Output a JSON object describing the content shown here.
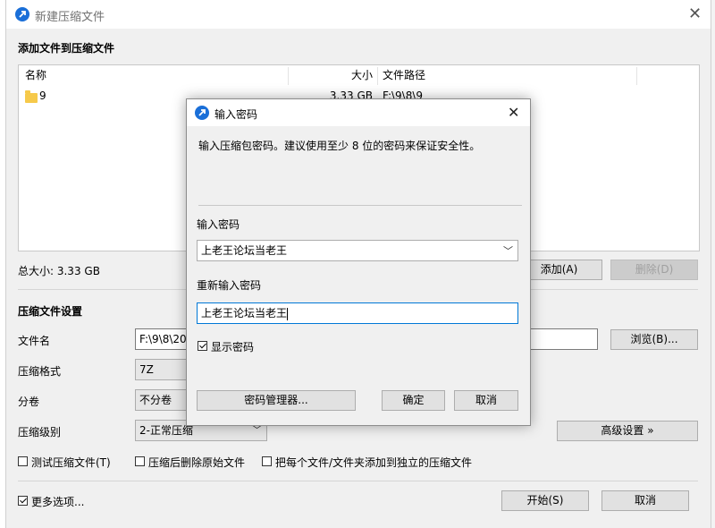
{
  "window": {
    "title": "新建压缩文件",
    "add_files_heading": "添加文件到压缩文件"
  },
  "file_list": {
    "columns": [
      "名称",
      "大小",
      "文件路径"
    ],
    "rows": [
      {
        "name": "9",
        "size": "3.33 GB",
        "path": "F:\\9\\8\\9"
      }
    ]
  },
  "summary": {
    "total_size": "总大小: 3.33 GB",
    "add_button": "添加(A)",
    "delete_button": "删除(D)"
  },
  "settings": {
    "heading": "压缩文件设置",
    "filename_label": "文件名",
    "filename_value": "F:\\9\\8\\20",
    "browse_button": "浏览(B)...",
    "format_label": "压缩格式",
    "format_value": "7Z",
    "split_label": "分卷",
    "split_value": "不分卷",
    "level_label": "压缩级别",
    "level_value": "2-正常压缩",
    "advanced_button": "高级设置 »",
    "test_checkbox": "测试压缩文件(T)",
    "delete_after_checkbox": "压缩后删除原始文件",
    "separate_checkbox": "把每个文件/文件夹添加到独立的压缩文件",
    "more_options_checkbox": "更多选项...",
    "start_button": "开始(S)",
    "cancel_button": "取消"
  },
  "password_dialog": {
    "title": "输入密码",
    "description": "输入压缩包密码。建议使用至少 8 位的密码来保证安全性。",
    "password_label": "输入密码",
    "password_value": "上老王论坛当老王",
    "confirm_label": "重新输入密码",
    "confirm_value": "上老王论坛当老王",
    "show_password_checkbox": "显示密码",
    "manager_button": "密码管理器...",
    "ok_button": "确定",
    "cancel_button": "取消"
  },
  "colors": {
    "accent": "#1a6fd8",
    "focus_border": "#0078d7",
    "folder": "#f6c94a"
  }
}
